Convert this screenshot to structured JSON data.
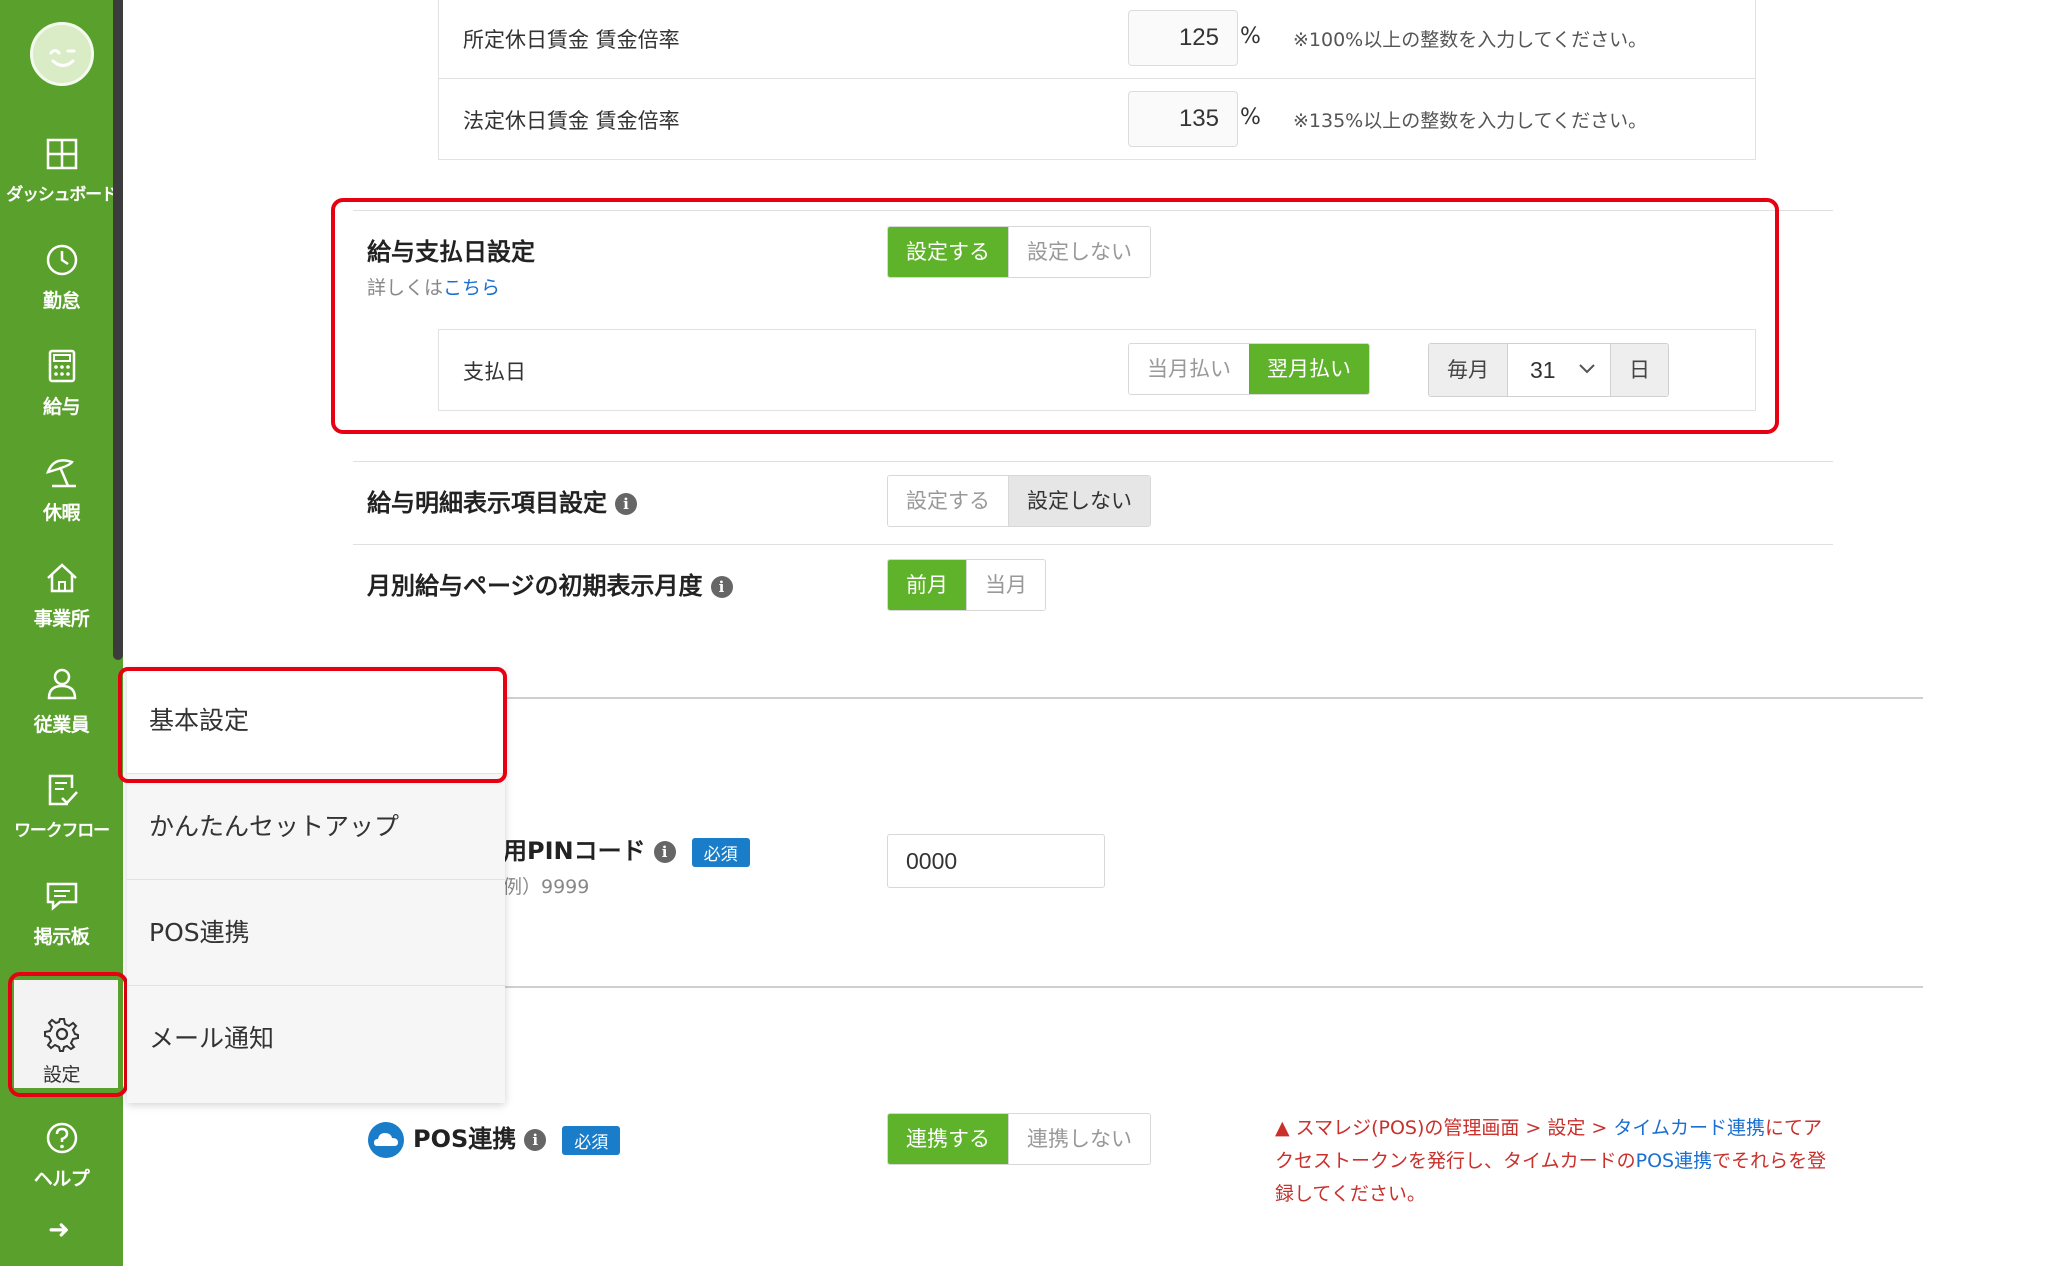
{
  "sidebar": {
    "items": [
      {
        "label": "ダッシュボード",
        "icon": "dashboard-icon"
      },
      {
        "label": "勤怠",
        "icon": "clock-icon"
      },
      {
        "label": "給与",
        "icon": "calculator-icon"
      },
      {
        "label": "休暇",
        "icon": "beach-umbrella-icon"
      },
      {
        "label": "事業所",
        "icon": "home-icon"
      },
      {
        "label": "従業員",
        "icon": "person-icon"
      },
      {
        "label": "ワークフロー",
        "icon": "workflow-icon"
      },
      {
        "label": "掲示板",
        "icon": "message-board-icon"
      },
      {
        "label": "設定",
        "icon": "gear-icon"
      },
      {
        "label": "ヘルプ",
        "icon": "help-icon"
      }
    ],
    "arrow": "➜"
  },
  "holiday_rates": [
    {
      "label": "所定休日賃金 賃金倍率",
      "value": "125",
      "unit": "%",
      "note": "※100%以上の整数を入力してください。"
    },
    {
      "label": "法定休日賃金 賃金倍率",
      "value": "135",
      "unit": "%",
      "note": "※135%以上の整数を入力してください。"
    }
  ],
  "payday_setting": {
    "title": "給与支払日設定",
    "sub_prefix": "詳しくは",
    "sub_link": "こちら",
    "options": [
      "設定する",
      "設定しない"
    ],
    "selected": "設定する",
    "payday": {
      "label": "支払日",
      "timing_options": [
        "当月払い",
        "翌月払い"
      ],
      "timing_selected": "翌月払い",
      "prefix": "毎月",
      "day_value": "31",
      "suffix": "日"
    }
  },
  "payslip_display": {
    "title": "給与明細表示項目設定",
    "options": [
      "設定する",
      "設定しない"
    ],
    "selected": "設定しない"
  },
  "monthly_initial": {
    "title": "月別給与ページの初期表示月度",
    "options": [
      "前月",
      "当月"
    ],
    "selected": "前月"
  },
  "pin_code": {
    "title_partial": "用PINコード",
    "required_badge": "必須",
    "example_partial": "例）9999",
    "value": "0000"
  },
  "pos_link": {
    "title": "POS連携",
    "required_badge": "必須",
    "options": [
      "連携する",
      "連携しない"
    ],
    "selected": "連携する",
    "warning_parts": {
      "p1": "スマレジ(POS)の管理画面 > 設定 > ",
      "link1": "タイムカード連携",
      "p2": "にてアクセストークンを発行し、タイムカードの",
      "link2": "POS連携",
      "p3": "でそれらを登録してください。"
    }
  },
  "settings_menu": {
    "items": [
      "基本設定",
      "かんたんセットアップ",
      "POS連携",
      "メール通知"
    ]
  },
  "colors": {
    "sidebar": "#5aa02c",
    "toggle_active": "#5fb32a",
    "highlight": "#e60012",
    "link": "#1a6fd1",
    "badge": "#1a7dc9",
    "warning": "#c9302c"
  }
}
